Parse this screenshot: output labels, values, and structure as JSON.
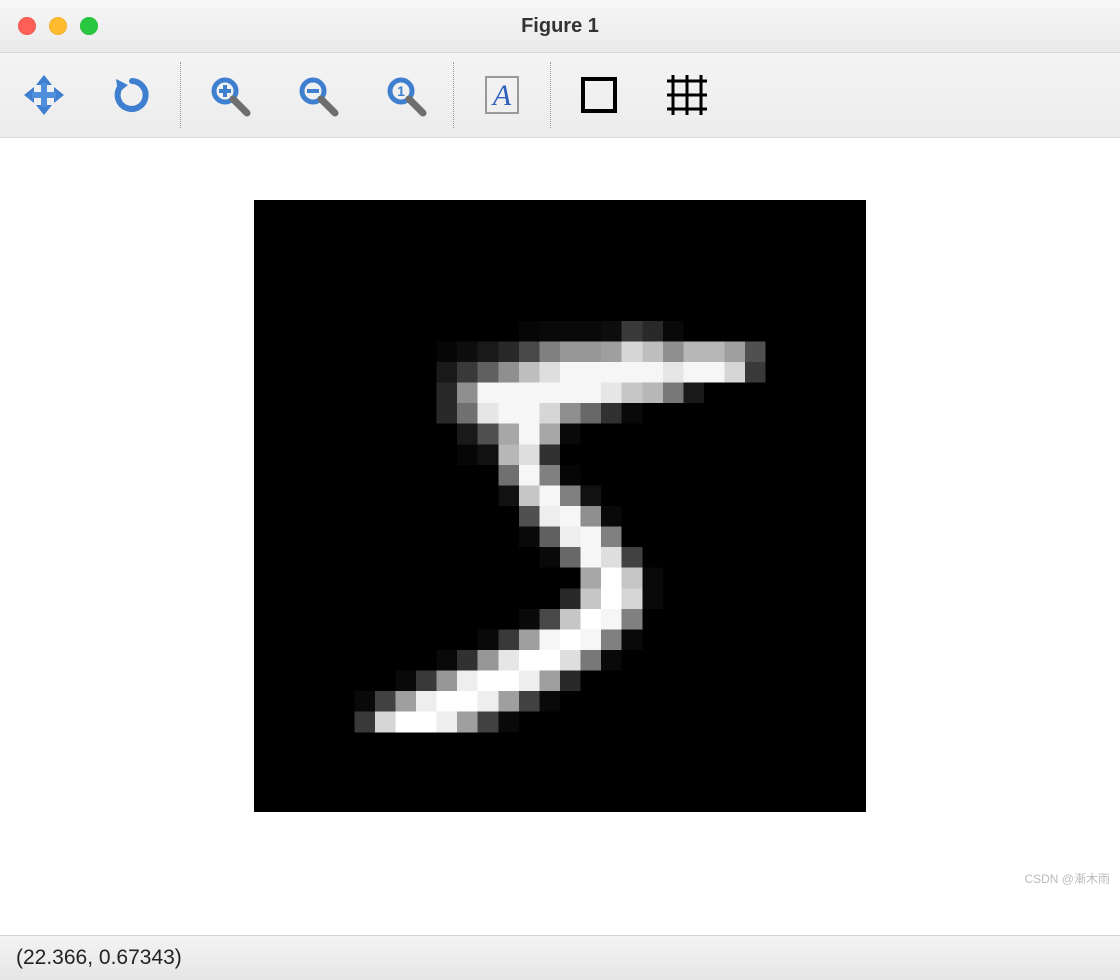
{
  "window": {
    "title": "Figure 1"
  },
  "toolbar": {
    "pan_icon": "pan-arrows-icon",
    "reload_icon": "reload-icon",
    "zoom_in_icon": "zoom-in-icon",
    "zoom_out_icon": "zoom-out-icon",
    "zoom_fit_icon": "zoom-reset-icon",
    "text_icon": "text-a-icon",
    "rect_icon": "rectangle-icon",
    "grid_icon": "grid-icon"
  },
  "status": {
    "coords": "(22.366, 0.67343)"
  },
  "watermark": "CSDN @漸木雨",
  "chart_data": {
    "type": "heatmap",
    "title": "",
    "xlabel": "",
    "ylabel": "",
    "rows": 28,
    "cols": 28,
    "vmin": -0.42,
    "vmax": 2.82,
    "cmap": "gray",
    "border_color": "#000000",
    "values": [
      [
        -0.42,
        -0.42,
        -0.42,
        -0.42,
        -0.42,
        -0.42,
        -0.42,
        -0.42,
        -0.42,
        -0.42,
        -0.42,
        -0.42,
        -0.42,
        -0.42,
        -0.42,
        -0.42,
        -0.42,
        -0.42,
        -0.42,
        -0.42,
        -0.42,
        -0.42,
        -0.42,
        -0.42,
        -0.42,
        -0.42,
        -0.42,
        -0.42
      ],
      [
        -0.42,
        -0.42,
        -0.42,
        -0.42,
        -0.42,
        -0.42,
        -0.42,
        -0.42,
        -0.42,
        -0.42,
        -0.42,
        -0.42,
        -0.42,
        -0.42,
        -0.42,
        -0.42,
        -0.42,
        -0.42,
        -0.42,
        -0.42,
        -0.42,
        -0.42,
        -0.42,
        -0.42,
        -0.42,
        -0.42,
        -0.42,
        -0.42
      ],
      [
        -0.42,
        -0.42,
        -0.42,
        -0.42,
        -0.42,
        -0.42,
        -0.42,
        -0.42,
        -0.42,
        -0.42,
        -0.42,
        -0.42,
        -0.42,
        -0.42,
        -0.42,
        -0.42,
        -0.42,
        -0.42,
        -0.42,
        -0.42,
        -0.42,
        -0.42,
        -0.42,
        -0.42,
        -0.42,
        -0.42,
        -0.42,
        -0.42
      ],
      [
        -0.42,
        -0.42,
        -0.42,
        -0.42,
        -0.42,
        -0.42,
        -0.42,
        -0.42,
        -0.42,
        -0.42,
        -0.42,
        -0.42,
        -0.42,
        -0.42,
        -0.42,
        -0.42,
        -0.42,
        -0.42,
        -0.42,
        -0.42,
        -0.42,
        -0.42,
        -0.42,
        -0.42,
        -0.42,
        -0.42,
        -0.42,
        -0.42
      ],
      [
        -0.42,
        -0.42,
        -0.42,
        -0.42,
        -0.42,
        -0.42,
        -0.42,
        -0.42,
        -0.42,
        -0.42,
        -0.42,
        -0.42,
        -0.42,
        -0.42,
        -0.42,
        -0.42,
        -0.42,
        -0.42,
        -0.42,
        -0.42,
        -0.42,
        -0.42,
        -0.42,
        -0.42,
        -0.42,
        -0.42,
        -0.42,
        -0.42
      ],
      [
        -0.42,
        -0.42,
        -0.42,
        -0.42,
        -0.42,
        -0.42,
        -0.42,
        -0.42,
        -0.42,
        -0.42,
        -0.42,
        -0.42,
        -0.35,
        -0.3,
        -0.3,
        -0.3,
        -0.25,
        0.3,
        0.1,
        -0.3,
        -0.42,
        -0.42,
        -0.42,
        -0.42,
        -0.42,
        -0.42,
        -0.42,
        -0.42
      ],
      [
        -0.42,
        -0.42,
        -0.42,
        -0.42,
        -0.42,
        -0.42,
        -0.42,
        -0.42,
        -0.35,
        -0.25,
        -0.1,
        0.1,
        0.5,
        1.2,
        1.5,
        1.5,
        1.6,
        2.3,
        2.0,
        1.4,
        1.9,
        1.9,
        1.6,
        0.6,
        -0.42,
        -0.42,
        -0.42,
        -0.42
      ],
      [
        -0.42,
        -0.42,
        -0.42,
        -0.42,
        -0.42,
        -0.42,
        -0.42,
        -0.42,
        -0.1,
        0.3,
        0.8,
        1.4,
        2.0,
        2.4,
        2.7,
        2.7,
        2.7,
        2.7,
        2.7,
        2.5,
        2.7,
        2.7,
        2.3,
        0.3,
        -0.42,
        -0.42,
        -0.42,
        -0.42
      ],
      [
        -0.42,
        -0.42,
        -0.42,
        -0.42,
        -0.42,
        -0.42,
        -0.42,
        -0.42,
        0.1,
        1.4,
        2.7,
        2.7,
        2.7,
        2.7,
        2.7,
        2.7,
        2.5,
        2.1,
        1.9,
        1.1,
        -0.1,
        -0.42,
        -0.42,
        -0.42,
        -0.42,
        -0.42,
        -0.42,
        -0.42
      ],
      [
        -0.42,
        -0.42,
        -0.42,
        -0.42,
        -0.42,
        -0.42,
        -0.42,
        -0.42,
        0.1,
        1.0,
        2.5,
        2.7,
        2.7,
        2.3,
        1.4,
        0.9,
        0.2,
        -0.3,
        -0.42,
        -0.42,
        -0.42,
        -0.42,
        -0.42,
        -0.42,
        -0.42,
        -0.42,
        -0.42,
        -0.42
      ],
      [
        -0.42,
        -0.42,
        -0.42,
        -0.42,
        -0.42,
        -0.42,
        -0.42,
        -0.42,
        -0.42,
        -0.1,
        0.6,
        1.7,
        2.7,
        1.7,
        -0.3,
        -0.42,
        -0.42,
        -0.42,
        -0.42,
        -0.42,
        -0.42,
        -0.42,
        -0.42,
        -0.42,
        -0.42,
        -0.42,
        -0.42,
        -0.42
      ],
      [
        -0.42,
        -0.42,
        -0.42,
        -0.42,
        -0.42,
        -0.42,
        -0.42,
        -0.42,
        -0.42,
        -0.35,
        -0.2,
        1.9,
        2.4,
        0.2,
        -0.42,
        -0.42,
        -0.42,
        -0.42,
        -0.42,
        -0.42,
        -0.42,
        -0.42,
        -0.42,
        -0.42,
        -0.42,
        -0.42,
        -0.42,
        -0.42
      ],
      [
        -0.42,
        -0.42,
        -0.42,
        -0.42,
        -0.42,
        -0.42,
        -0.42,
        -0.42,
        -0.42,
        -0.42,
        -0.42,
        1.0,
        2.7,
        1.2,
        -0.35,
        -0.42,
        -0.42,
        -0.42,
        -0.42,
        -0.42,
        -0.42,
        -0.42,
        -0.42,
        -0.42,
        -0.42,
        -0.42,
        -0.42,
        -0.42
      ],
      [
        -0.42,
        -0.42,
        -0.42,
        -0.42,
        -0.42,
        -0.42,
        -0.42,
        -0.42,
        -0.42,
        -0.42,
        -0.42,
        -0.2,
        2.1,
        2.7,
        1.2,
        -0.2,
        -0.42,
        -0.42,
        -0.42,
        -0.42,
        -0.42,
        -0.42,
        -0.42,
        -0.42,
        -0.42,
        -0.42,
        -0.42,
        -0.42
      ],
      [
        -0.42,
        -0.42,
        -0.42,
        -0.42,
        -0.42,
        -0.42,
        -0.42,
        -0.42,
        -0.42,
        -0.42,
        -0.42,
        -0.42,
        0.6,
        2.6,
        2.7,
        1.4,
        -0.3,
        -0.42,
        -0.42,
        -0.42,
        -0.42,
        -0.42,
        -0.42,
        -0.42,
        -0.42,
        -0.42,
        -0.42,
        -0.42
      ],
      [
        -0.42,
        -0.42,
        -0.42,
        -0.42,
        -0.42,
        -0.42,
        -0.42,
        -0.42,
        -0.42,
        -0.42,
        -0.42,
        -0.42,
        -0.3,
        0.8,
        2.6,
        2.7,
        1.2,
        -0.42,
        -0.42,
        -0.42,
        -0.42,
        -0.42,
        -0.42,
        -0.42,
        -0.42,
        -0.42,
        -0.42,
        -0.42
      ],
      [
        -0.42,
        -0.42,
        -0.42,
        -0.42,
        -0.42,
        -0.42,
        -0.42,
        -0.42,
        -0.42,
        -0.42,
        -0.42,
        -0.42,
        -0.42,
        -0.3,
        0.9,
        2.7,
        2.4,
        0.4,
        -0.42,
        -0.42,
        -0.42,
        -0.42,
        -0.42,
        -0.42,
        -0.42,
        -0.42,
        -0.42,
        -0.42
      ],
      [
        -0.42,
        -0.42,
        -0.42,
        -0.42,
        -0.42,
        -0.42,
        -0.42,
        -0.42,
        -0.42,
        -0.42,
        -0.42,
        -0.42,
        -0.42,
        -0.42,
        -0.42,
        1.7,
        2.82,
        2.1,
        -0.3,
        -0.42,
        -0.42,
        -0.42,
        -0.42,
        -0.42,
        -0.42,
        -0.42,
        -0.42,
        -0.42
      ],
      [
        -0.42,
        -0.42,
        -0.42,
        -0.42,
        -0.42,
        -0.42,
        -0.42,
        -0.42,
        -0.42,
        -0.42,
        -0.42,
        -0.42,
        -0.42,
        -0.42,
        0.1,
        2.1,
        2.82,
        2.3,
        -0.3,
        -0.42,
        -0.42,
        -0.42,
        -0.42,
        -0.42,
        -0.42,
        -0.42,
        -0.42,
        -0.42
      ],
      [
        -0.42,
        -0.42,
        -0.42,
        -0.42,
        -0.42,
        -0.42,
        -0.42,
        -0.42,
        -0.42,
        -0.42,
        -0.42,
        -0.42,
        -0.3,
        0.5,
        2.1,
        2.82,
        2.7,
        1.2,
        -0.42,
        -0.42,
        -0.42,
        -0.42,
        -0.42,
        -0.42,
        -0.42,
        -0.42,
        -0.42,
        -0.42
      ],
      [
        -0.42,
        -0.42,
        -0.42,
        -0.42,
        -0.42,
        -0.42,
        -0.42,
        -0.42,
        -0.42,
        -0.42,
        -0.3,
        0.3,
        1.6,
        2.7,
        2.82,
        2.7,
        1.2,
        -0.3,
        -0.42,
        -0.42,
        -0.42,
        -0.42,
        -0.42,
        -0.42,
        -0.42,
        -0.42,
        -0.42,
        -0.42
      ],
      [
        -0.42,
        -0.42,
        -0.42,
        -0.42,
        -0.42,
        -0.42,
        -0.42,
        -0.42,
        -0.3,
        0.2,
        1.5,
        2.5,
        2.82,
        2.82,
        2.4,
        1.1,
        -0.3,
        -0.42,
        -0.42,
        -0.42,
        -0.42,
        -0.42,
        -0.42,
        -0.42,
        -0.42,
        -0.42,
        -0.42,
        -0.42
      ],
      [
        -0.42,
        -0.42,
        -0.42,
        -0.42,
        -0.42,
        -0.42,
        -0.3,
        0.3,
        1.5,
        2.6,
        2.82,
        2.82,
        2.6,
        1.6,
        0.1,
        -0.42,
        -0.42,
        -0.42,
        -0.42,
        -0.42,
        -0.42,
        -0.42,
        -0.42,
        -0.42,
        -0.42,
        -0.42,
        -0.42,
        -0.42
      ],
      [
        -0.42,
        -0.42,
        -0.42,
        -0.42,
        -0.3,
        0.4,
        1.6,
        2.6,
        2.82,
        2.82,
        2.6,
        1.6,
        0.4,
        -0.3,
        -0.42,
        -0.42,
        -0.42,
        -0.42,
        -0.42,
        -0.42,
        -0.42,
        -0.42,
        -0.42,
        -0.42,
        -0.42,
        -0.42,
        -0.42,
        -0.42
      ],
      [
        -0.42,
        -0.42,
        -0.42,
        -0.42,
        0.3,
        2.3,
        2.82,
        2.82,
        2.6,
        1.6,
        0.4,
        -0.3,
        -0.42,
        -0.42,
        -0.42,
        -0.42,
        -0.42,
        -0.42,
        -0.42,
        -0.42,
        -0.42,
        -0.42,
        -0.42,
        -0.42,
        -0.42,
        -0.42,
        -0.42,
        -0.42
      ],
      [
        -0.42,
        -0.42,
        -0.42,
        -0.42,
        -0.42,
        -0.42,
        -0.42,
        -0.42,
        -0.42,
        -0.42,
        -0.42,
        -0.42,
        -0.42,
        -0.42,
        -0.42,
        -0.42,
        -0.42,
        -0.42,
        -0.42,
        -0.42,
        -0.42,
        -0.42,
        -0.42,
        -0.42,
        -0.42,
        -0.42,
        -0.42,
        -0.42
      ],
      [
        -0.42,
        -0.42,
        -0.42,
        -0.42,
        -0.42,
        -0.42,
        -0.42,
        -0.42,
        -0.42,
        -0.42,
        -0.42,
        -0.42,
        -0.42,
        -0.42,
        -0.42,
        -0.42,
        -0.42,
        -0.42,
        -0.42,
        -0.42,
        -0.42,
        -0.42,
        -0.42,
        -0.42,
        -0.42,
        -0.42,
        -0.42,
        -0.42
      ],
      [
        -0.42,
        -0.42,
        -0.42,
        -0.42,
        -0.42,
        -0.42,
        -0.42,
        -0.42,
        -0.42,
        -0.42,
        -0.42,
        -0.42,
        -0.42,
        -0.42,
        -0.42,
        -0.42,
        -0.42,
        -0.42,
        -0.42,
        -0.42,
        -0.42,
        -0.42,
        -0.42,
        -0.42,
        -0.42,
        -0.42,
        -0.42,
        -0.42
      ]
    ]
  }
}
